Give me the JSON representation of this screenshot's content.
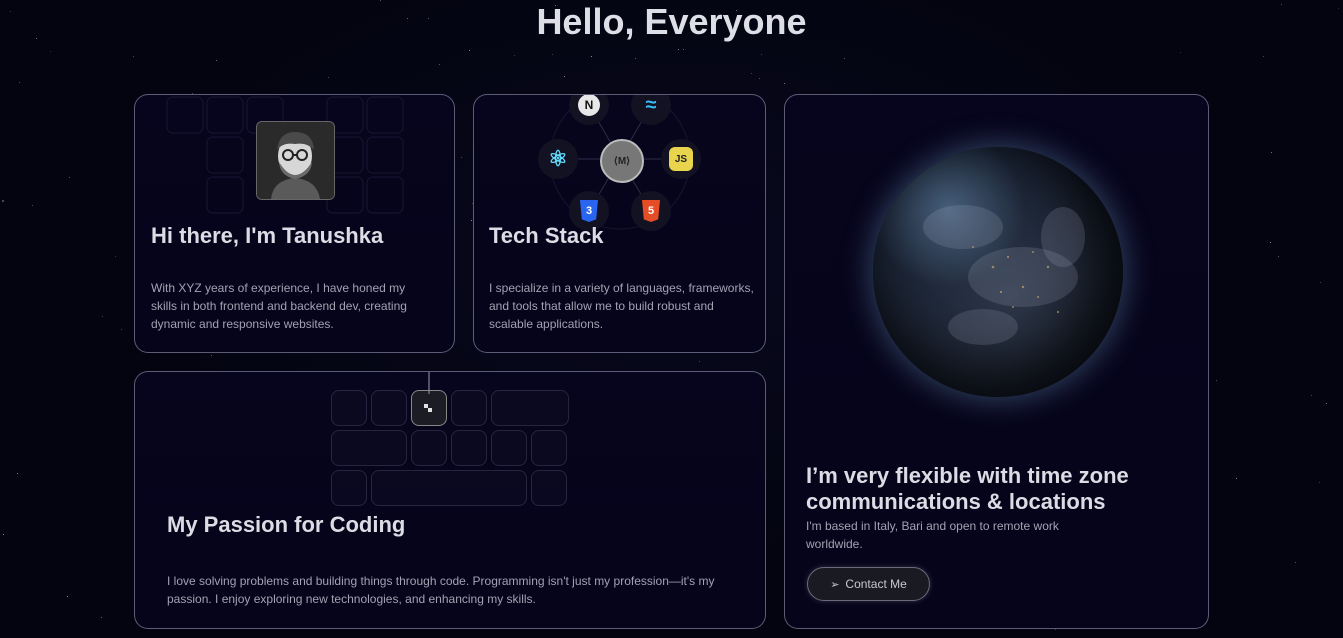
{
  "hero": {
    "title": "Hello, Everyone"
  },
  "intro_card": {
    "title": "Hi there, I'm Tanushka",
    "text": "With XYZ years of experience, I have honed my skills in both frontend and backend dev, creating dynamic and responsive websites."
  },
  "tech_card": {
    "title": "Tech Stack",
    "text": "I specialize in a variety of languages, frameworks, and tools that allow me to build robust and scalable applications.",
    "icons": [
      {
        "name": "nextjs-icon",
        "glyph": "N"
      },
      {
        "name": "tailwind-icon",
        "glyph": "≈"
      },
      {
        "name": "react-icon",
        "glyph": "⚛"
      },
      {
        "name": "vite-icon",
        "glyph": "⟨M⟩"
      },
      {
        "name": "javascript-icon",
        "glyph": "JS"
      },
      {
        "name": "css3-icon",
        "glyph": "3"
      },
      {
        "name": "html5-icon",
        "glyph": "5"
      }
    ]
  },
  "location_card": {
    "title": "I’m very flexible with time zone communications & locations",
    "text": "I'm based in Italy, Bari and open to remote work worldwide.",
    "button_label": "Contact Me",
    "button_icon": "send-icon"
  },
  "passion_card": {
    "title": "My Passion for Coding",
    "text": "I love solving problems and building things through code. Programming isn't just my profession—it's my passion. I enjoy exploring new technologies, and enhancing my skills."
  },
  "colors": {
    "background": "#03040f",
    "card_border": "#c8c8e6",
    "title": "#dcdce4",
    "body_text": "#a2a2b2"
  }
}
